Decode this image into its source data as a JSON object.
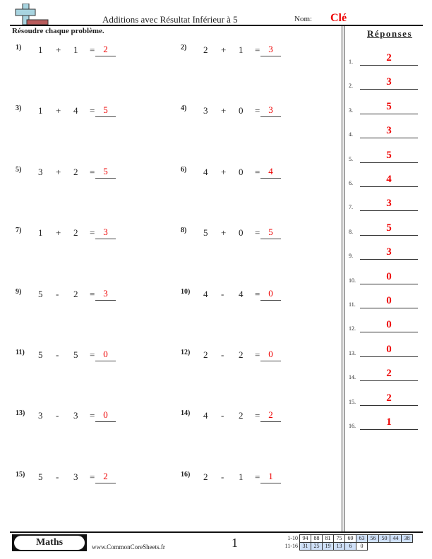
{
  "header": {
    "title": "Additions avec Résultat Inférieur à 5",
    "name_label": "Nom:",
    "name_value": "Clé",
    "instructions": "Résoudre chaque problème."
  },
  "problems": [
    {
      "num": "1)",
      "a": "1",
      "op": "+",
      "b": "1",
      "eq": "=",
      "answer": "2"
    },
    {
      "num": "2)",
      "a": "2",
      "op": "+",
      "b": "1",
      "eq": "=",
      "answer": "3"
    },
    {
      "num": "3)",
      "a": "1",
      "op": "+",
      "b": "4",
      "eq": "=",
      "answer": "5"
    },
    {
      "num": "4)",
      "a": "3",
      "op": "+",
      "b": "0",
      "eq": "=",
      "answer": "3"
    },
    {
      "num": "5)",
      "a": "3",
      "op": "+",
      "b": "2",
      "eq": "=",
      "answer": "5"
    },
    {
      "num": "6)",
      "a": "4",
      "op": "+",
      "b": "0",
      "eq": "=",
      "answer": "4"
    },
    {
      "num": "7)",
      "a": "1",
      "op": "+",
      "b": "2",
      "eq": "=",
      "answer": "3"
    },
    {
      "num": "8)",
      "a": "5",
      "op": "+",
      "b": "0",
      "eq": "=",
      "answer": "5"
    },
    {
      "num": "9)",
      "a": "5",
      "op": "-",
      "b": "2",
      "eq": "=",
      "answer": "3"
    },
    {
      "num": "10)",
      "a": "4",
      "op": "-",
      "b": "4",
      "eq": "=",
      "answer": "0"
    },
    {
      "num": "11)",
      "a": "5",
      "op": "-",
      "b": "5",
      "eq": "=",
      "answer": "0"
    },
    {
      "num": "12)",
      "a": "2",
      "op": "-",
      "b": "2",
      "eq": "=",
      "answer": "0"
    },
    {
      "num": "13)",
      "a": "3",
      "op": "-",
      "b": "3",
      "eq": "=",
      "answer": "0"
    },
    {
      "num": "14)",
      "a": "4",
      "op": "-",
      "b": "2",
      "eq": "=",
      "answer": "2"
    },
    {
      "num": "15)",
      "a": "5",
      "op": "-",
      "b": "3",
      "eq": "=",
      "answer": "2"
    },
    {
      "num": "16)",
      "a": "2",
      "op": "-",
      "b": "1",
      "eq": "=",
      "answer": "1"
    }
  ],
  "answer_key": {
    "title": "Réponses",
    "items": [
      {
        "num": "1.",
        "answer": "2"
      },
      {
        "num": "2.",
        "answer": "3"
      },
      {
        "num": "3.",
        "answer": "5"
      },
      {
        "num": "4.",
        "answer": "3"
      },
      {
        "num": "5.",
        "answer": "5"
      },
      {
        "num": "6.",
        "answer": "4"
      },
      {
        "num": "7.",
        "answer": "3"
      },
      {
        "num": "8.",
        "answer": "5"
      },
      {
        "num": "9.",
        "answer": "3"
      },
      {
        "num": "10.",
        "answer": "0"
      },
      {
        "num": "11.",
        "answer": "0"
      },
      {
        "num": "12.",
        "answer": "0"
      },
      {
        "num": "13.",
        "answer": "0"
      },
      {
        "num": "14.",
        "answer": "2"
      },
      {
        "num": "15.",
        "answer": "2"
      },
      {
        "num": "16.",
        "answer": "1"
      }
    ]
  },
  "footer": {
    "subject": "Maths",
    "website": "www.CommonCoreSheets.fr",
    "page": "1",
    "score_rows": [
      {
        "label": "1-10",
        "cells": [
          {
            "v": "94",
            "blue": false
          },
          {
            "v": "88",
            "blue": false
          },
          {
            "v": "81",
            "blue": false
          },
          {
            "v": "75",
            "blue": false
          },
          {
            "v": "69",
            "blue": false
          },
          {
            "v": "63",
            "blue": true
          },
          {
            "v": "56",
            "blue": true
          },
          {
            "v": "50",
            "blue": true
          },
          {
            "v": "44",
            "blue": true
          },
          {
            "v": "38",
            "blue": true
          }
        ]
      },
      {
        "label": "11-16",
        "cells": [
          {
            "v": "31",
            "blue": true
          },
          {
            "v": "25",
            "blue": true
          },
          {
            "v": "19",
            "blue": true
          },
          {
            "v": "13",
            "blue": true
          },
          {
            "v": "6",
            "blue": true
          },
          {
            "v": "0",
            "blue": false
          }
        ]
      }
    ]
  },
  "colors": {
    "answer": "#ee0000",
    "score_highlight": "#cfe0f8",
    "logo_cross": "#a8d4e0",
    "logo_bar": "#b85c5c"
  }
}
